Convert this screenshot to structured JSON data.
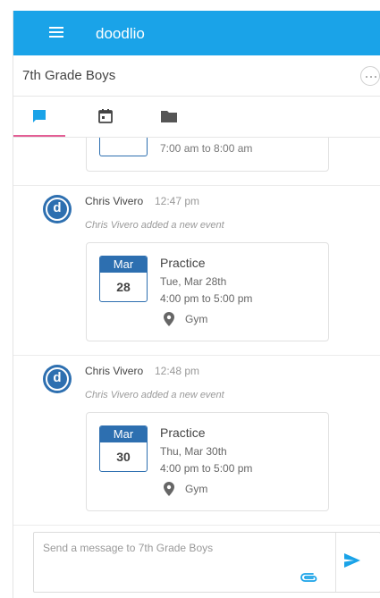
{
  "app": {
    "title": "doodlio"
  },
  "group": {
    "title": "7th Grade Boys"
  },
  "feed": {
    "partial_event": {
      "time": "7:00 am to 8:00 am"
    },
    "posts": [
      {
        "author": "Chris Vivero",
        "time": "12:47 pm",
        "note": "Chris Vivero added a new event",
        "avatar_letter": "d",
        "event": {
          "month": "Mar",
          "day": "28",
          "title": "Practice",
          "date": "Tue, Mar 28th",
          "time": "4:00 pm to 5:00 pm",
          "location": "Gym"
        }
      },
      {
        "author": "Chris Vivero",
        "time": "12:48 pm",
        "note": "Chris Vivero added a new event",
        "avatar_letter": "d",
        "event": {
          "month": "Mar",
          "day": "30",
          "title": "Practice",
          "date": "Thu, Mar 30th",
          "time": "4:00 pm to 5:00 pm",
          "location": "Gym"
        }
      }
    ]
  },
  "composer": {
    "placeholder": "Send a message to 7th Grade Boys",
    "value": ""
  },
  "icons": {
    "menu": "hamburger-menu-icon",
    "more": "more-options-icon",
    "chat": "chat-bubble-icon",
    "calendar": "calendar-icon",
    "folder": "folder-icon",
    "location": "map-pin-icon",
    "attach": "paperclip-icon",
    "send": "send-arrow-icon"
  },
  "colors": {
    "appbar": "#1aa3e8",
    "active_tab_underline": "#e35f95",
    "calendar_accent": "#2d6fb0",
    "send": "#1aa3e8"
  }
}
